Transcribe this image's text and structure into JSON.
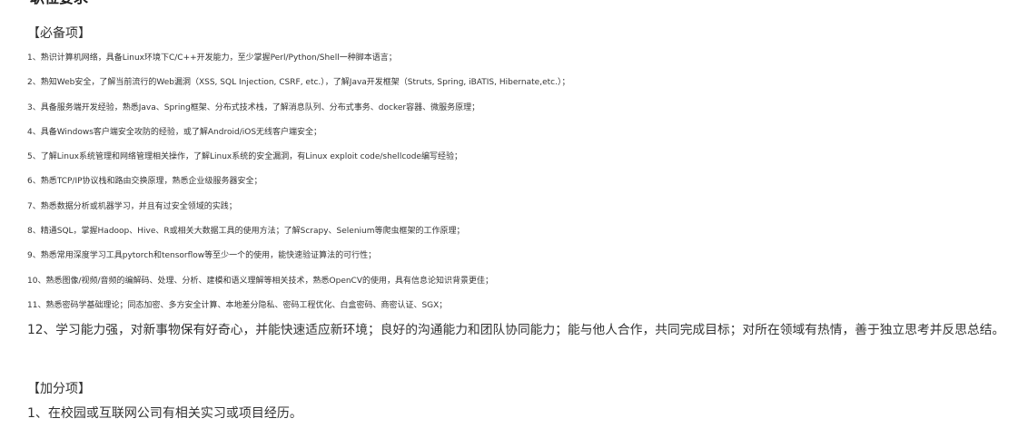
{
  "page": {
    "title": "职位要求"
  },
  "required": {
    "header": "【必备项】",
    "items": [
      "1、熟识计算机网络，具备Linux环境下C/C++开发能力，至少掌握Perl/Python/Shell一种脚本语言；",
      "2、熟知Web安全，了解当前流行的Web漏洞（XSS, SQL Injection, CSRF, etc.），了解Java开发框架（Struts, Spring, iBATIS, Hibernate,etc.）；",
      "3、具备服务端开发经验，熟悉Java、Spring框架、分布式技术栈，了解消息队列、分布式事务、docker容器、微服务原理；",
      "4、具备Windows客户端安全攻防的经验，或了解Android/iOS无线客户端安全；",
      "5、了解Linux系统管理和网络管理相关操作，了解Linux系统的安全漏洞，有Linux exploit code/shellcode编写经验；",
      "6、熟悉TCP/IP协议栈和路由交换原理，熟悉企业级服务器安全；",
      "7、熟悉数据分析或机器学习，并且有过安全领域的实践；",
      "8、精通SQL，掌握Hadoop、Hive、R或相关大数据工具的使用方法；了解Scrapy、Selenium等爬虫框架的工作原理；",
      "9、熟悉常用深度学习工具pytorch和tensorflow等至少一个的使用，能快速验证算法的可行性；",
      "10、熟悉图像/视频/音频的编解码、处理、分析、建模和语义理解等相关技术，熟悉OpenCV的使用，具有信息论知识背景更佳；",
      "11、熟悉密码学基础理论；同态加密、多方安全计算、本地差分隐私、密码工程优化、白盒密码、商密认证、SGX；",
      "12、学习能力强，对新事物保有好奇心，并能快速适应新环境；良好的沟通能力和团队协同能力；能与他人合作，共同完成目标；对所在领域有热情，善于独立思考并反思总结。"
    ]
  },
  "bonus": {
    "header": "【加分项】",
    "items": [
      "1、在校园或互联网公司有相关实习或项目经历。"
    ]
  }
}
